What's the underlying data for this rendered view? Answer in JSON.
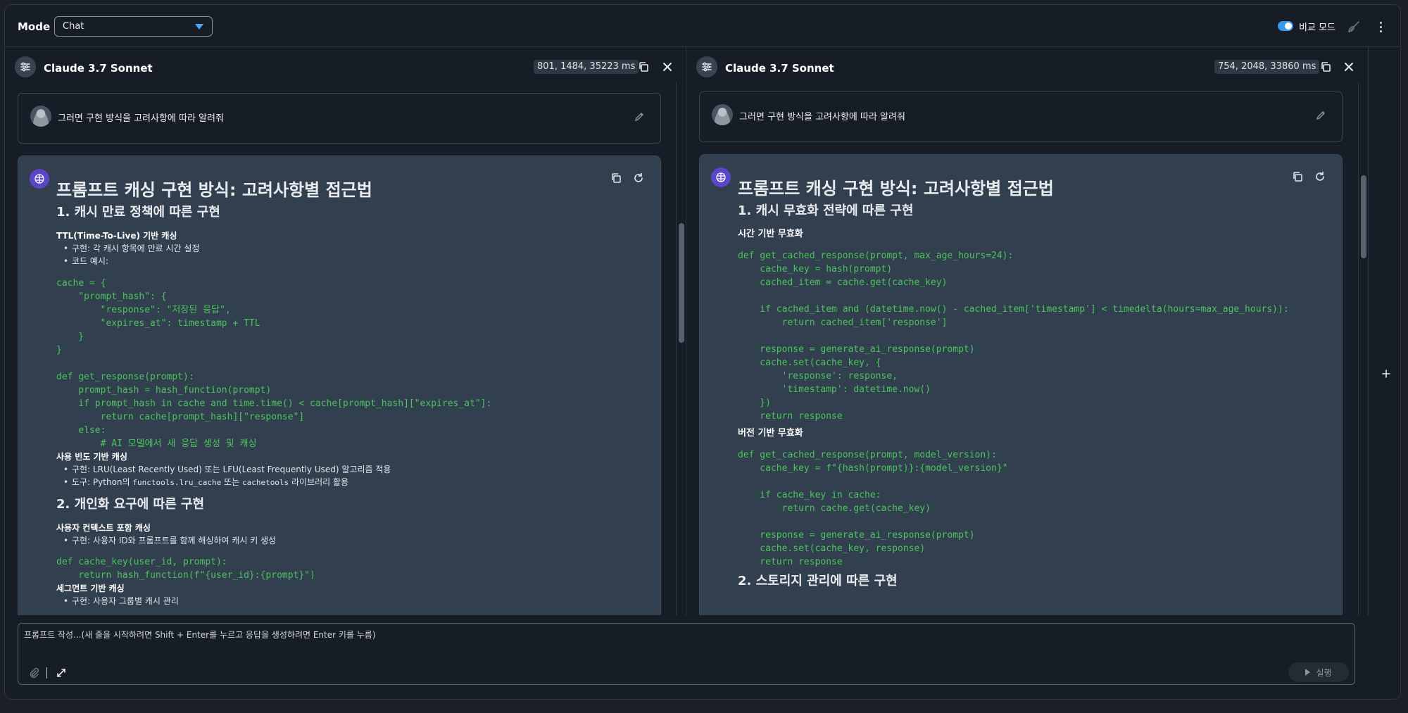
{
  "header": {
    "mode_label": "Mode",
    "mode_value": "Chat",
    "compare_mode_label": "비교 모드",
    "compare_mode_on": true
  },
  "panels": [
    {
      "model_name": "Claude 3.7 Sonnet",
      "stats": "801, 1484, 35223 ms",
      "user_message": "그러면 구현 방식을 고려사항에 따라 알려줘",
      "title": "프롬프트 캐싱 구현 방식: 고려사항별 접근법",
      "sec1": "1. 캐시 만료 정책에 따른 구현",
      "sub1": "TTL(Time-To-Live) 기반 캐싱",
      "b1": "구현: 각 캐시 항목에 만료 시간 설정",
      "b2": "코드 예시:",
      "code1": "cache = {\n    \"prompt_hash\": {\n        \"response\": \"저장된 응답\",\n        \"expires_at\": timestamp + TTL\n    }\n}\n\ndef get_response(prompt):\n    prompt_hash = hash_function(prompt)\n    if prompt_hash in cache and time.time() < cache[prompt_hash][\"expires_at\"]:\n        return cache[prompt_hash][\"response\"]\n    else:\n        # AI 모델에서 새 응답 생성 및 캐싱",
      "sub2": "사용 빈도 기반 캐싱",
      "b3": "구현: LRU(Least Recently Used) 또는 LFU(Least Frequently Used) 알고리즘 적용",
      "b4_pre": "도구: Python의 ",
      "b4_code1": "functools.lru_cache",
      "b4_mid": " 또는 ",
      "b4_code2": "cachetools",
      "b4_post": " 라이브러리 활용",
      "sec2": "2. 개인화 요구에 따른 구현",
      "sub3": "사용자 컨텍스트 포함 캐싱",
      "b5": "구현: 사용자 ID와 프롬프트를 함께 해싱하여 캐시 키 생성",
      "code2": "def cache_key(user_id, prompt):\n    return hash_function(f\"{user_id}:{prompt}\")",
      "sub4": "세그먼트 기반 캐싱",
      "b6": "구현: 사용자 그룹별 캐시 관리"
    },
    {
      "model_name": "Claude 3.7 Sonnet",
      "stats": "754, 2048, 33860 ms",
      "user_message": "그러면 구현 방식을 고려사항에 따라 알려줘",
      "title": "프롬프트 캐싱 구현 방식: 고려사항별 접근법",
      "sec1": "1. 캐시 무효화 전략에 따른 구현",
      "sub1": "시간 기반 무효화",
      "code1": "def get_cached_response(prompt, max_age_hours=24):\n    cache_key = hash(prompt)\n    cached_item = cache.get(cache_key)\n\n    if cached_item and (datetime.now() - cached_item['timestamp'] < timedelta(hours=max_age_hours)):\n        return cached_item['response']\n\n    response = generate_ai_response(prompt)\n    cache.set(cache_key, {\n        'response': response,\n        'timestamp': datetime.now()\n    })\n    return response",
      "sub2": "버전 기반 무효화",
      "code2": "def get_cached_response(prompt, model_version):\n    cache_key = f\"{hash(prompt)}:{model_version}\"\n\n    if cache_key in cache:\n        return cache.get(cache_key)\n\n    response = generate_ai_response(prompt)\n    cache.set(cache_key, response)\n    return response",
      "sec2": "2. 스토리지 관리에 따른 구현"
    }
  ],
  "input": {
    "placeholder": "프롬프트 작성...(새 줄을 시작하려면 Shift + Enter를 누르고 응답을 생성하려면 Enter 키를 누름)",
    "run_label": "실행"
  },
  "icons": {
    "settings": "sliders-icon",
    "copy": "copy-icon",
    "close": "close-icon",
    "edit": "pencil-icon",
    "regenerate": "refresh-icon",
    "attach": "paperclip-icon",
    "expand": "expand-icon",
    "add": "plus-icon",
    "clear": "broom-icon",
    "more": "kebab-icon"
  },
  "colors": {
    "accent": "#3b97e8",
    "code": "#4cc35d",
    "ai_bubble": "#323f4e",
    "background": "#161d26"
  }
}
